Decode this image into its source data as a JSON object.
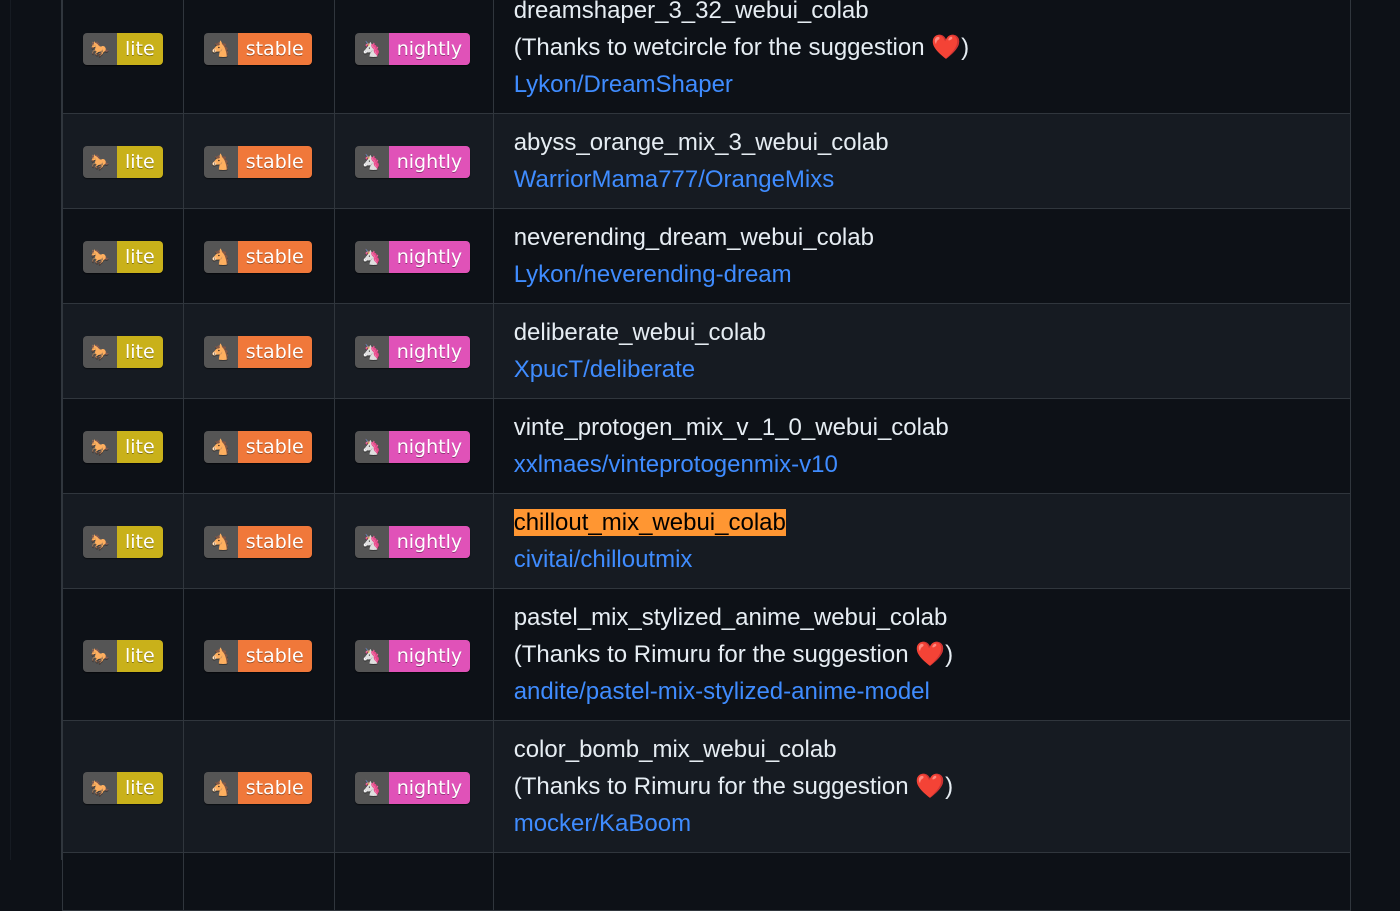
{
  "badges": {
    "lite": {
      "icon": "horse-icon",
      "glyph": "🐎",
      "label": "lite",
      "color": "#c9b11a"
    },
    "stable": {
      "icon": "horse-face-icon",
      "glyph": "🐴",
      "label": "stable",
      "color": "#f0783a"
    },
    "nightly": {
      "icon": "unicorn-icon",
      "glyph": "🦄",
      "label": "nightly",
      "color": "#e052b8"
    }
  },
  "rows": [
    {
      "name": "dreamshaper_3_32_webui_colab",
      "note": "(Thanks to wetcircle for the suggestion ❤️)",
      "link": "Lykon/DreamShaper"
    },
    {
      "name": "abyss_orange_mix_3_webui_colab",
      "link": "WarriorMama777/OrangeMixs"
    },
    {
      "name": "neverending_dream_webui_colab",
      "link": "Lykon/neverending-dream"
    },
    {
      "name": "deliberate_webui_colab",
      "link": "XpucT/deliberate"
    },
    {
      "name": "vinte_protogen_mix_v_1_0_webui_colab",
      "link": "xxlmaes/vinteprotogenmix-v10"
    },
    {
      "name": "chillout_mix_webui_colab",
      "link": "civitai/chilloutmix",
      "highlighted": true
    },
    {
      "name": "pastel_mix_stylized_anime_webui_colab",
      "note": "(Thanks to Rimuru for the suggestion ❤️)",
      "link": "andite/pastel-mix-stylized-anime-model"
    },
    {
      "name": "color_bomb_mix_webui_colab",
      "note": "(Thanks to Rimuru for the suggestion ❤️)",
      "link": "mocker/KaBoom"
    },
    {
      "name": "",
      "link": ""
    }
  ],
  "highlight_color": "#ff9632",
  "link_color": "#3f8cff"
}
